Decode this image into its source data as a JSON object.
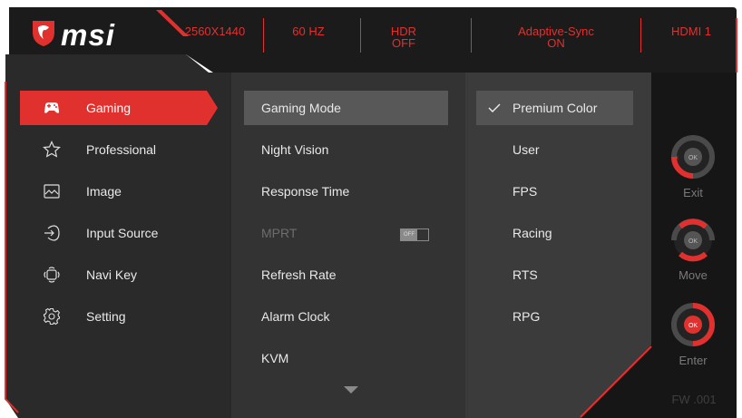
{
  "brand": {
    "logo_text": "msi",
    "logo_icon": "msi-dragon-shield-icon"
  },
  "header": {
    "resolution": "2560X1440",
    "refresh": "60 HZ",
    "hdr_line1": "HDR",
    "hdr_line2": "OFF",
    "sync_line1": "Adaptive-Sync",
    "sync_line2": "ON",
    "input": "HDMI 1"
  },
  "menu": {
    "items": [
      {
        "label": "Gaming",
        "icon": "gamepad-icon"
      },
      {
        "label": "Professional",
        "icon": "star-icon"
      },
      {
        "label": "Image",
        "icon": "image-icon"
      },
      {
        "label": "Input Source",
        "icon": "input-source-icon"
      },
      {
        "label": "Navi Key",
        "icon": "navi-key-icon"
      },
      {
        "label": "Setting",
        "icon": "gear-icon"
      }
    ]
  },
  "gaming": {
    "items": [
      {
        "label": "Gaming Mode"
      },
      {
        "label": "Night Vision"
      },
      {
        "label": "Response Time"
      },
      {
        "label": "MPRT",
        "toggle": "OFF"
      },
      {
        "label": "Refresh Rate"
      },
      {
        "label": "Alarm Clock"
      },
      {
        "label": "KVM"
      }
    ]
  },
  "modes": {
    "items": [
      {
        "label": "Premium Color",
        "checked": true
      },
      {
        "label": "User"
      },
      {
        "label": "FPS"
      },
      {
        "label": "Racing"
      },
      {
        "label": "RTS"
      },
      {
        "label": "RPG"
      }
    ]
  },
  "nav": {
    "exit": "Exit",
    "move": "Move",
    "enter": "Enter",
    "ok": "OK",
    "firmware": "FW .001"
  },
  "colors": {
    "accent": "#e0312f",
    "panel_dark": "#1c1c1c",
    "panel_mid": "#2f2f2f",
    "panel_right": "#3a3a3a"
  }
}
